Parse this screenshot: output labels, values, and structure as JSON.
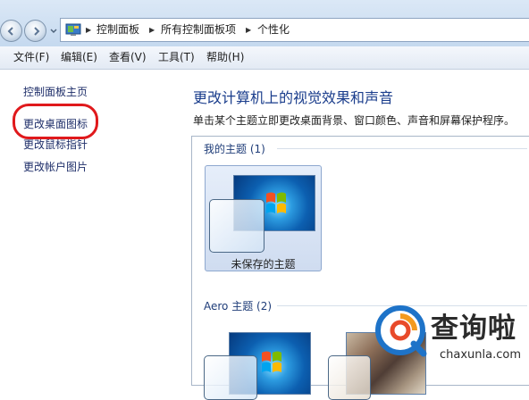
{
  "address_bar": {
    "breadcrumbs": [
      "控制面板",
      "所有控制面板项",
      "个性化"
    ]
  },
  "menu": {
    "items": [
      "文件(F)",
      "编辑(E)",
      "查看(V)",
      "工具(T)",
      "帮助(H)"
    ]
  },
  "sidebar": {
    "links": [
      "控制面板主页",
      "更改桌面图标",
      "更改鼠标指针",
      "更改帐户图片"
    ],
    "highlighted": "更改桌面图标",
    "highlight_color": "#e0191c"
  },
  "main": {
    "title": "更改计算机上的视觉效果和声音",
    "subtitle": "单击某个主题立即更改桌面背景、窗口颜色、声音和屏幕保护程序。",
    "groups": [
      {
        "label": "我的主题 (1)",
        "themes": [
          {
            "name": "未保存的主题",
            "selected": true
          }
        ]
      },
      {
        "label": "Aero 主题 (2)"
      }
    ]
  },
  "watermark": {
    "title": "查询啦",
    "url": "chaxunla.com",
    "colors": [
      "#1e73c8",
      "#f39a1e",
      "#e84a2a"
    ]
  },
  "colors": {
    "title_blue": "#1a3d8c",
    "link_blue": "#1f2f6a"
  }
}
